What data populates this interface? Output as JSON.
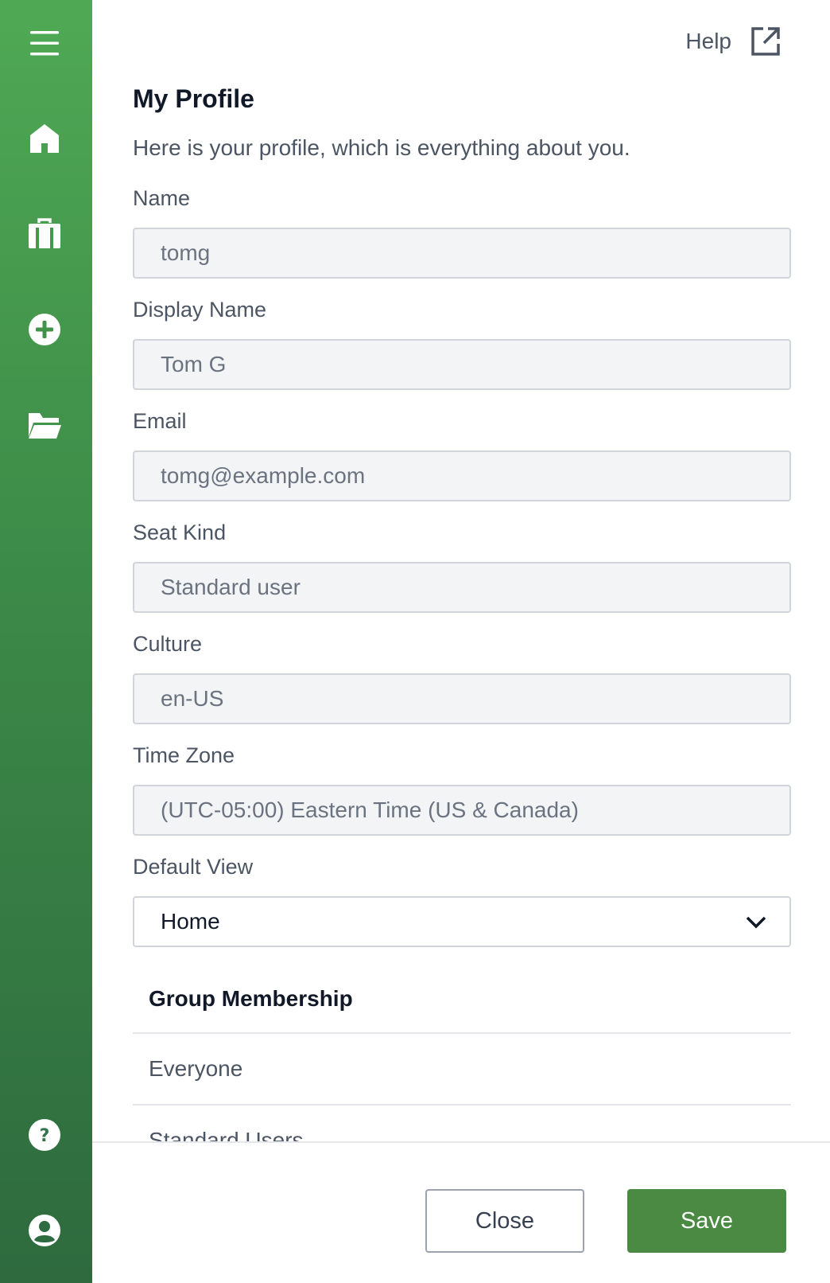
{
  "sidebar": {
    "items": [
      {
        "icon": "menu-icon"
      },
      {
        "icon": "home-icon"
      },
      {
        "icon": "briefcase-icon"
      },
      {
        "icon": "plus-circle-icon"
      },
      {
        "icon": "folder-open-icon"
      },
      {
        "icon": "help-circle-icon"
      },
      {
        "icon": "user-circle-icon"
      }
    ],
    "colors": {
      "top": "#4fa954",
      "bottom": "#2e6a3e",
      "icon": "#ffffff"
    }
  },
  "header": {
    "help_label": "Help",
    "help_icon": "external-link-icon"
  },
  "page": {
    "title": "My Profile",
    "subtitle": "Here is your profile, which is everything about you."
  },
  "fields": {
    "name": {
      "label": "Name",
      "value": "tomg"
    },
    "display_name": {
      "label": "Display Name",
      "value": "Tom G"
    },
    "email": {
      "label": "Email",
      "value": "tomg@example.com"
    },
    "seat_kind": {
      "label": "Seat Kind",
      "value": "Standard user"
    },
    "culture": {
      "label": "Culture",
      "value": "en-US"
    },
    "time_zone": {
      "label": "Time Zone",
      "value": "(UTC-05:00) Eastern Time (US & Canada)"
    },
    "default_view": {
      "label": "Default View",
      "value": "Home"
    }
  },
  "groups": {
    "heading": "Group Membership",
    "items": [
      "Everyone",
      "Standard Users"
    ]
  },
  "footer": {
    "close_label": "Close",
    "save_label": "Save",
    "save_color": "#4a8a42"
  }
}
